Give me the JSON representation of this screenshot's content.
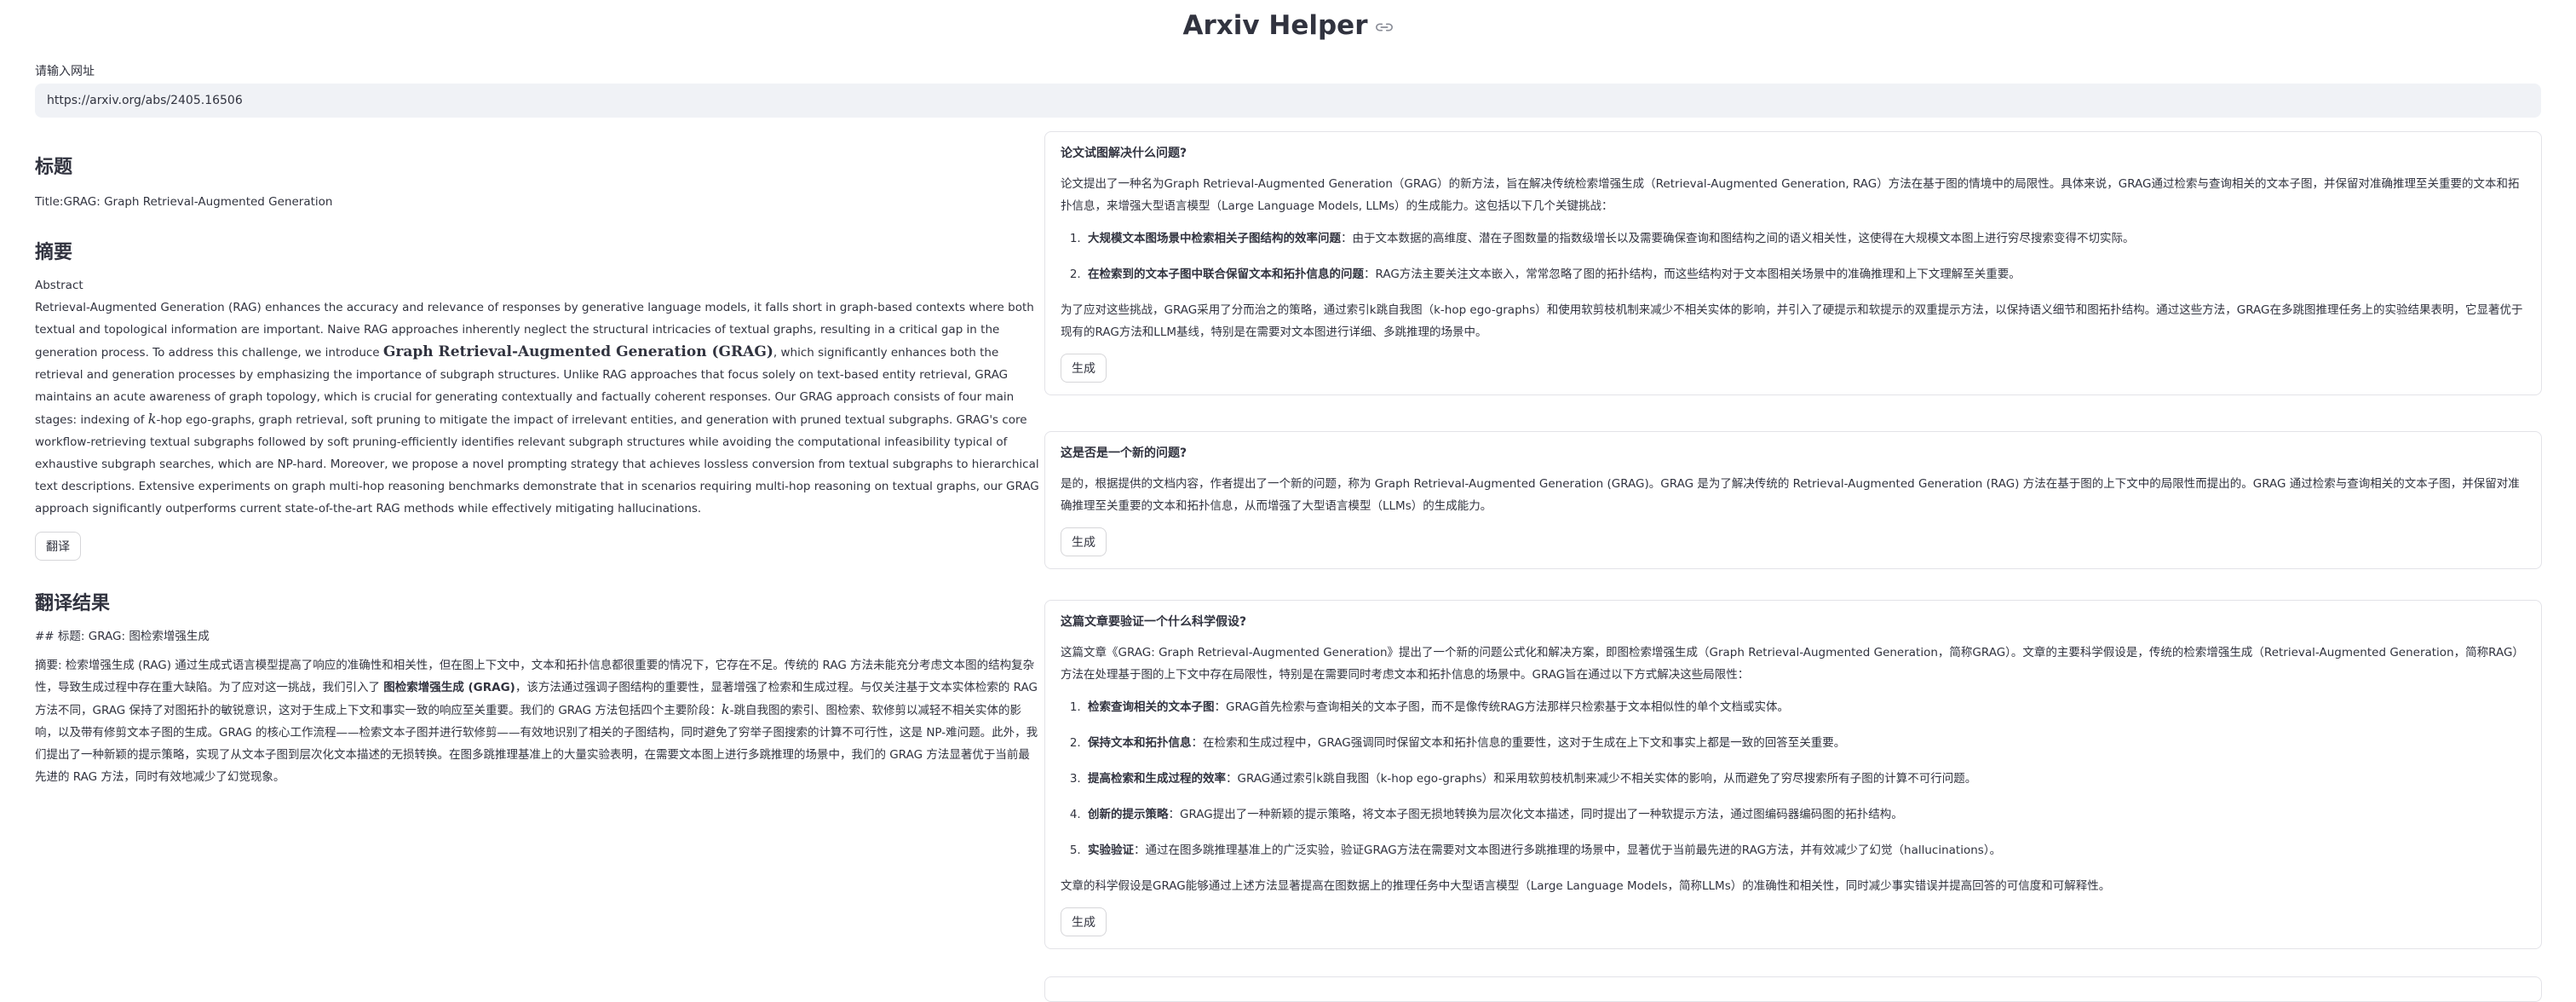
{
  "app": {
    "title": "Arxiv Helper"
  },
  "url_input": {
    "label": "请输入网址",
    "value": "https://arxiv.org/abs/2405.16506"
  },
  "left": {
    "title_heading": "标题",
    "title_text": "Title:GRAG: Graph Retrieval-Augmented Generation",
    "abstract_heading": "摘要",
    "abstract_label": "Abstract",
    "abstract_pre": "Retrieval-Augmented Generation (RAG) enhances the accuracy and relevance of responses by generative language models, it falls short in graph-based contexts where both textual and topological information are important. Naive RAG approaches inherently neglect the structural intricacies of textual graphs, resulting in a critical gap in the generation process. To address this challenge, we introduce ",
    "abstract_bold": "Graph Retrieval-Augmented Generation (GRAG)",
    "abstract_mid": ", which significantly enhances both the retrieval and generation processes by emphasizing the importance of subgraph structures. Unlike RAG approaches that focus solely on text-based entity retrieval, GRAG maintains an acute awareness of graph topology, which is crucial for generating contextually and factually coherent responses. Our GRAG approach consists of four main stages: indexing of ",
    "abstract_k": "k",
    "abstract_post": "-hop ego-graphs, graph retrieval, soft pruning to mitigate the impact of irrelevant entities, and generation with pruned textual subgraphs. GRAG's core workflow-retrieving textual subgraphs followed by soft pruning-efficiently identifies relevant subgraph structures while avoiding the computational infeasibility typical of exhaustive subgraph searches, which are NP-hard. Moreover, we propose a novel prompting strategy that achieves lossless conversion from textual subgraphs to hierarchical text descriptions. Extensive experiments on graph multi-hop reasoning benchmarks demonstrate that in scenarios requiring multi-hop reasoning on textual graphs, our GRAG approach significantly outperforms current state-of-the-art RAG methods while effectively mitigating hallucinations.",
    "translate_button": "翻译",
    "translation_heading": "翻译结果",
    "translation_title": "## 标题: GRAG: 图检索增强生成",
    "translation_pre": "摘要: 检索增强生成 (RAG) 通过生成式语言模型提高了响应的准确性和相关性，但在图上下文中，文本和拓扑信息都很重要的情况下，它存在不足。传统的 RAG 方法未能充分考虑文本图的结构复杂性，导致生成过程中存在重大缺陷。为了应对这一挑战，我们引入了 ",
    "translation_bold": "图检索增强生成 (GRAG)",
    "translation_mid": "，该方法通过强调子图结构的重要性，显著增强了检索和生成过程。与仅关注基于文本实体检索的 RAG 方法不同，GRAG 保持了对图拓扑的敏锐意识，这对于生成上下文和事实一致的响应至关重要。我们的 GRAG 方法包括四个主要阶段：",
    "translation_k": "k",
    "translation_post": "-跳自我图的索引、图检索、软修剪以减轻不相关实体的影响，以及带有修剪文本子图的生成。GRAG 的核心工作流程——检索文本子图并进行软修剪——有效地识别了相关的子图结构，同时避免了穷举子图搜索的计算不可行性，这是 NP-难问题。此外，我们提出了一种新颖的提示策略，实现了从文本子图到层次化文本描述的无损转换。在图多跳推理基准上的大量实验表明，在需要文本图上进行多跳推理的场景中，我们的 GRAG 方法显著优于当前最先进的 RAG 方法，同时有效地减少了幻觉现象。"
  },
  "cards": [
    {
      "question": "论文试图解决什么问题?",
      "intro": "论文提出了一种名为Graph Retrieval-Augmented Generation（GRAG）的新方法，旨在解决传统检索增强生成（Retrieval-Augmented Generation, RAG）方法在基于图的情境中的局限性。具体来说，GRAG通过检索与查询相关的文本子图，并保留对准确推理至关重要的文本和拓扑信息，来增强大型语言模型（Large Language Models, LLMs）的生成能力。这包括以下几个关键挑战：",
      "items": [
        {
          "bold": "大规模文本图场景中检索相关子图结构的效率问题",
          "text": "：由于文本数据的高维度、潜在子图数量的指数级增长以及需要确保查询和图结构之间的语义相关性，这使得在大规模文本图上进行穷尽搜索变得不切实际。"
        },
        {
          "bold": "在检索到的文本子图中联合保留文本和拓扑信息的问题",
          "text": "：RAG方法主要关注文本嵌入，常常忽略了图的拓扑结构，而这些结构对于文本图相关场景中的准确推理和上下文理解至关重要。"
        }
      ],
      "outro": "为了应对这些挑战，GRAG采用了分而治之的策略，通过索引k跳自我图（k-hop ego-graphs）和使用软剪枝机制来减少不相关实体的影响，并引入了硬提示和软提示的双重提示方法，以保持语义细节和图拓扑结构。通过这些方法，GRAG在多跳图推理任务上的实验结果表明，它显著优于现有的RAG方法和LLM基线，特别是在需要对文本图进行详细、多跳推理的场景中。",
      "button": "生成"
    },
    {
      "question": "这是否是一个新的问题?",
      "intro": "是的，根据提供的文档内容，作者提出了一个新的问题，称为 Graph Retrieval-Augmented Generation (GRAG)。GRAG 是为了解决传统的 Retrieval-Augmented Generation (RAG) 方法在基于图的上下文中的局限性而提出的。GRAG 通过检索与查询相关的文本子图，并保留对准确推理至关重要的文本和拓扑信息，从而增强了大型语言模型（LLMs）的生成能力。",
      "items": [],
      "outro": "",
      "button": "生成"
    },
    {
      "question": "这篇文章要验证一个什么科学假设?",
      "intro": "这篇文章《GRAG: Graph Retrieval-Augmented Generation》提出了一个新的问题公式化和解决方案，即图检索增强生成（Graph Retrieval-Augmented Generation，简称GRAG）。文章的主要科学假设是，传统的检索增强生成（Retrieval-Augmented Generation，简称RAG）方法在处理基于图的上下文中存在局限性，特别是在需要同时考虑文本和拓扑信息的场景中。GRAG旨在通过以下方式解决这些局限性：",
      "items": [
        {
          "bold": "检索查询相关的文本子图",
          "text": "：GRAG首先检索与查询相关的文本子图，而不是像传统RAG方法那样只检索基于文本相似性的单个文档或实体。"
        },
        {
          "bold": "保持文本和拓扑信息",
          "text": "：在检索和生成过程中，GRAG强调同时保留文本和拓扑信息的重要性，这对于生成在上下文和事实上都是一致的回答至关重要。"
        },
        {
          "bold": "提高检索和生成过程的效率",
          "text": "：GRAG通过索引k跳自我图（k-hop ego-graphs）和采用软剪枝机制来减少不相关实体的影响，从而避免了穷尽搜索所有子图的计算不可行问题。"
        },
        {
          "bold": "创新的提示策略",
          "text": "：GRAG提出了一种新颖的提示策略，将文本子图无损地转换为层次化文本描述，同时提出了一种软提示方法，通过图编码器编码图的拓扑结构。"
        },
        {
          "bold": "实验验证",
          "text": "：通过在图多跳推理基准上的广泛实验，验证GRAG方法在需要对文本图进行多跳推理的场景中，显著优于当前最先进的RAG方法，并有效减少了幻觉（hallucinations）。"
        }
      ],
      "outro": "文章的科学假设是GRAG能够通过上述方法显著提高在图数据上的推理任务中大型语言模型（Large Language Models，简称LLMs）的准确性和相关性，同时减少事实错误并提高回答的可信度和可解释性。",
      "button": "生成"
    }
  ]
}
